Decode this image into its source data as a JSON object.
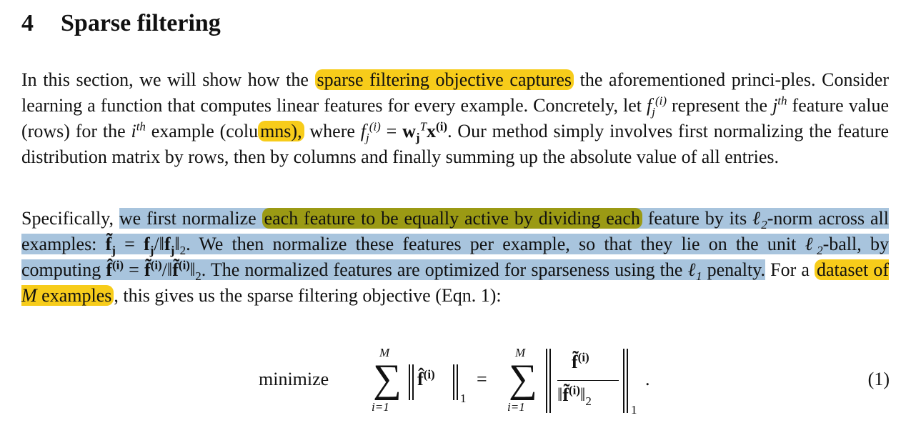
{
  "section": {
    "number": "4",
    "title": "Sparse filtering"
  },
  "p1": {
    "s1a": "In this section, we will show how the ",
    "s1b": "sparse filtering objective captures",
    "s1c": " the aforementioned princi-ples. Consider learning a function that computes linear features for every example. Concretely, let ",
    "s2": " represent the ",
    "s3": " feature value (rows) for the ",
    "s4": " example (colu",
    "s4b": "mns),",
    "s5": " where ",
    "s6": ". Our method simply involves first normalizing the feature distribution matrix by rows, then by columns and finally summing up the absolute value of all entries."
  },
  "p2": {
    "s1": "Specifically, ",
    "s2": "we first normalize ",
    "s3": "each feature to be equally active by dividing each",
    "s4": " feature by its ",
    "s5": "-norm across all examples: ",
    "s6": ". We then normalize these features per example, so that they lie on the unit ",
    "s7": "-ball, by computing ",
    "s8": ". The normalized features are optimized for sparseness using the ",
    "s9": " penalty.",
    "s10": " For a ",
    "s11": "dataset of ",
    "s12": " examples",
    "s13": ", this gives us the sparse filtering objective (Eqn. 1):"
  },
  "equation": {
    "word": "minimize",
    "upper": "M",
    "lower": "i=1",
    "number": "(1)"
  },
  "colors": {
    "yellow": "#f7cc1a",
    "blue": "#a8c4dd",
    "olive": "#9b9a14"
  }
}
